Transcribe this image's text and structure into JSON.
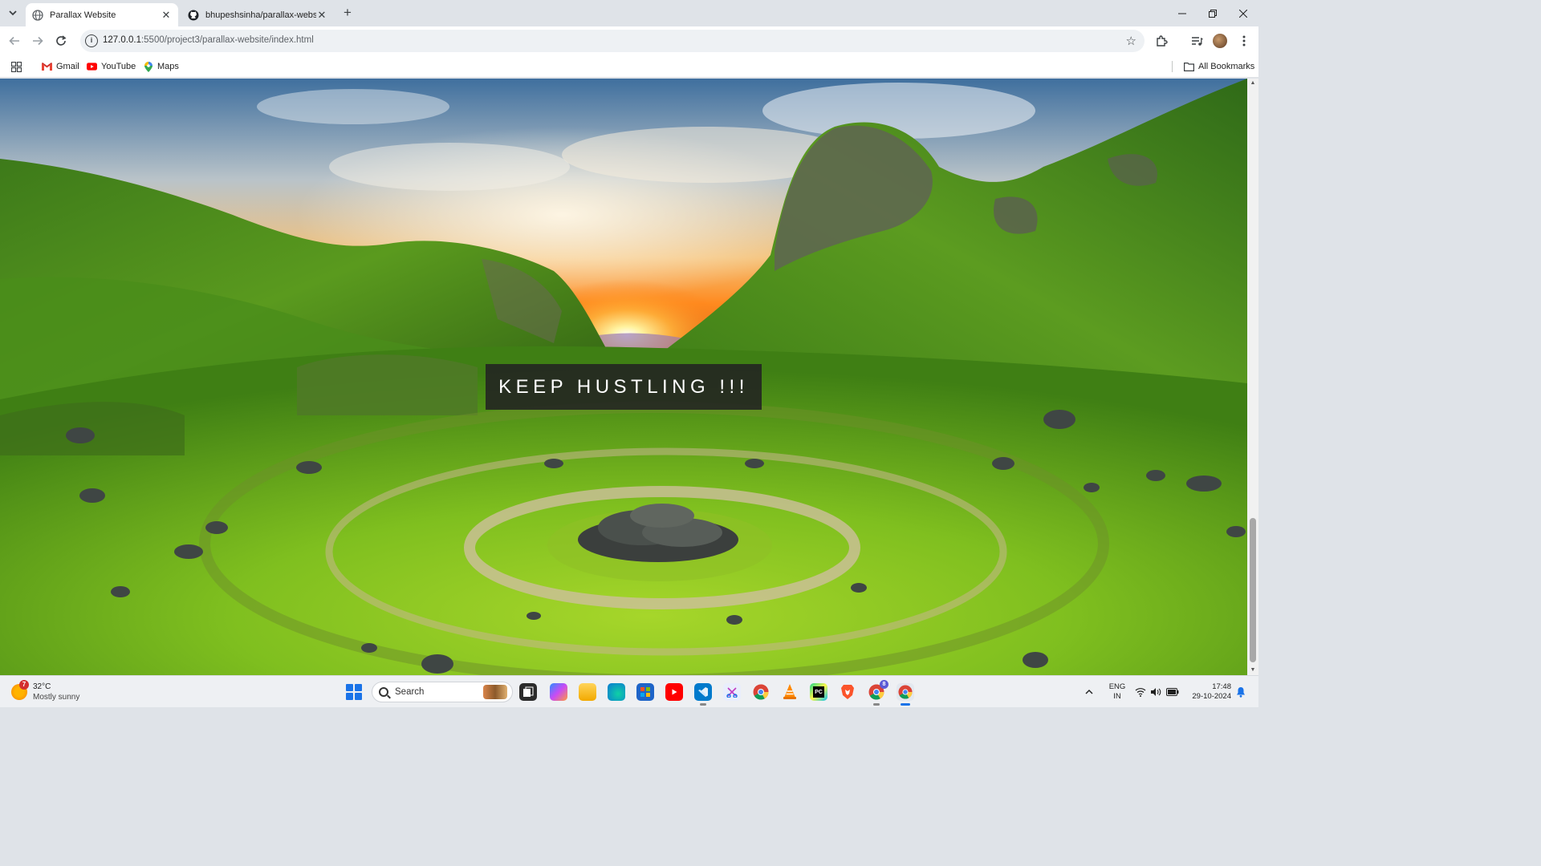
{
  "browser": {
    "tabs": [
      {
        "title": "Parallax Website",
        "active": true
      },
      {
        "title": "bhupeshsinha/parallax-website",
        "active": false
      }
    ],
    "address": {
      "host": "127.0.0.1",
      "path": ":5500/project3/parallax-website/index.html"
    },
    "bookmarks": [
      {
        "label": "Gmail",
        "icon": "gmail-icon"
      },
      {
        "label": "YouTube",
        "icon": "youtube-icon"
      },
      {
        "label": "Maps",
        "icon": "maps-icon"
      }
    ],
    "all_bookmarks_label": "All Bookmarks"
  },
  "page": {
    "hero_text": "KEEP HUSTLING !!!",
    "background": "valley landscape with sunset and spiral stone circle"
  },
  "taskbar": {
    "weather": {
      "badge": "7",
      "temp": "32°C",
      "condition": "Mostly sunny"
    },
    "search_placeholder": "Search",
    "apps": [
      "task-view",
      "copilot",
      "file-explorer",
      "edge",
      "microsoft-store",
      "youtube",
      "vs-code",
      "snipping-tool",
      "chrome",
      "vlc",
      "pycharm",
      "brave",
      "chrome-profile",
      "chrome-active"
    ],
    "chrome_profile_badge": "8",
    "lang": {
      "line1": "ENG",
      "line2": "IN"
    },
    "clock": {
      "time": "17:48",
      "date": "29-10-2024"
    }
  },
  "colors": {
    "hero_box": "#222222",
    "hero_text": "#ffffff",
    "accent": "#1a73e8"
  }
}
